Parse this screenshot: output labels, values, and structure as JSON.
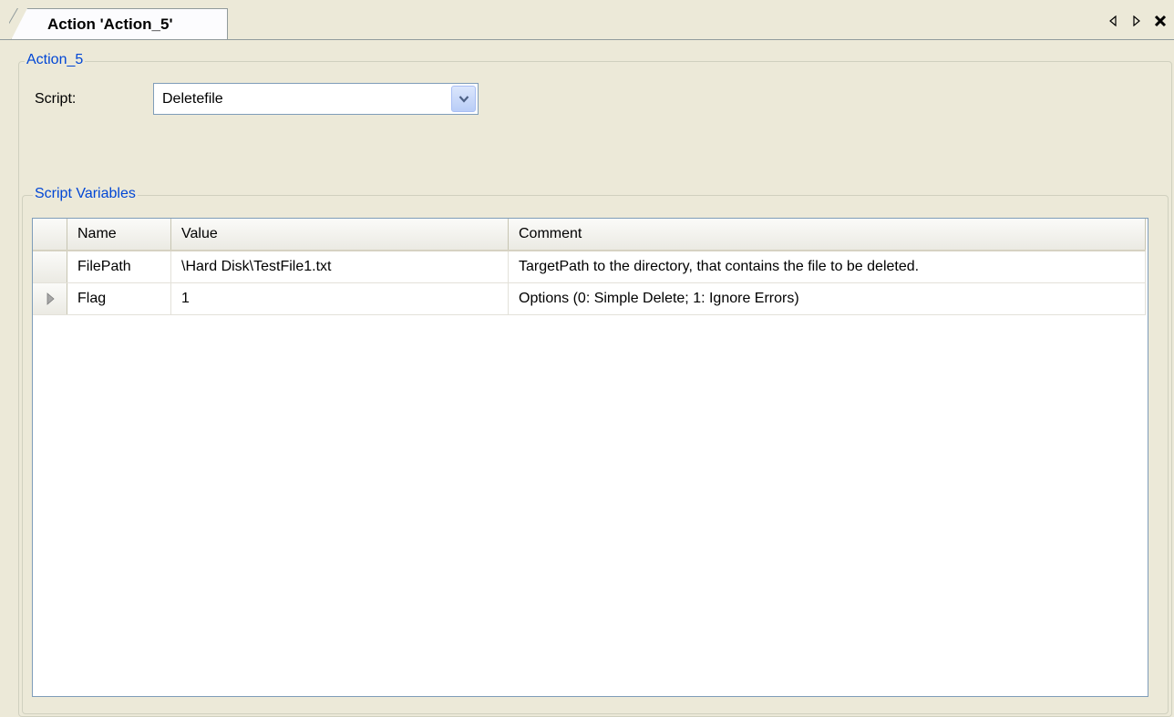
{
  "tab": {
    "label": "Action 'Action_5'"
  },
  "tab_controls": {
    "prev_icon": "triangle-left-icon",
    "next_icon": "triangle-right-icon",
    "close_icon": "close-icon"
  },
  "action_group": {
    "legend": "Action_5",
    "script_label": "Script:",
    "script_value": "Deletefile"
  },
  "variables_group": {
    "legend": "Script Variables"
  },
  "grid": {
    "columns": [
      "Name",
      "Value",
      "Comment"
    ],
    "rows": [
      {
        "name": "FilePath",
        "value": "\\Hard Disk\\TestFile1.txt",
        "comment": "TargetPath to the directory, that contains the file to be deleted."
      },
      {
        "name": "Flag",
        "value": "1",
        "comment": "Options (0: Simple Delete; 1: Ignore Errors)"
      }
    ]
  },
  "colors": {
    "background": "#ece9d8",
    "legend_text": "#0046d5",
    "grid_border": "#7f9db9"
  }
}
